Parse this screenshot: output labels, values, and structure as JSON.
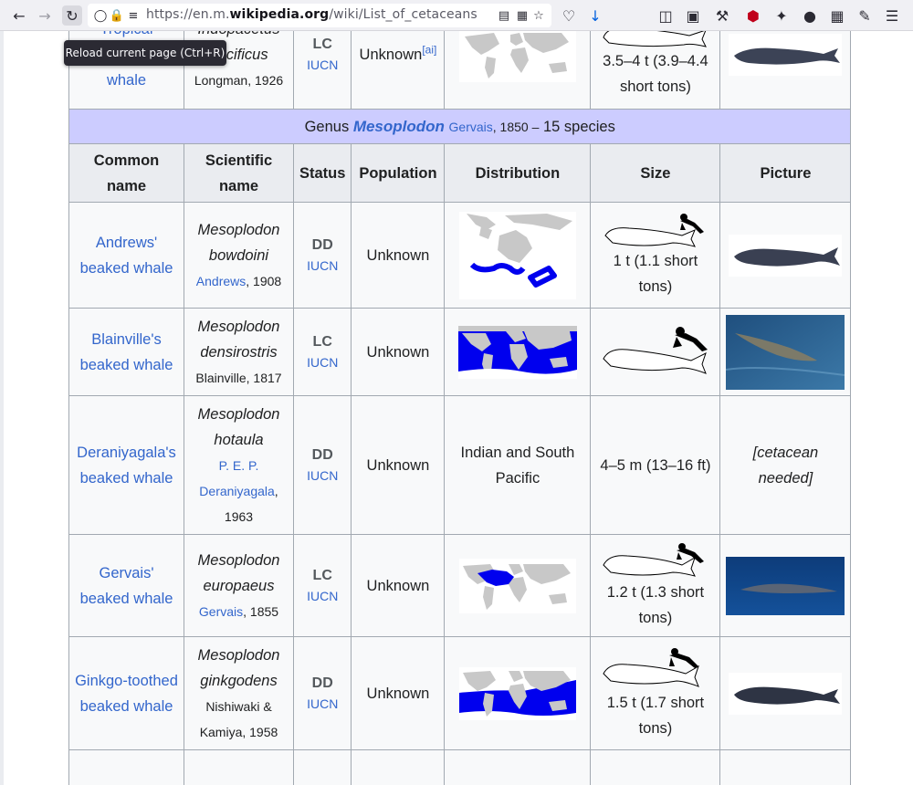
{
  "browser": {
    "url_prefix": "https://en.m.",
    "url_domain": "wikipedia.org",
    "url_path": "/wiki/List_of_cetaceans",
    "tooltip": "Reload current page (Ctrl+R)"
  },
  "prev_row": {
    "common": "Tropical bottlenose whale",
    "scientific": "Indopacetus pacificus",
    "authority": "Longman, 1926",
    "status": "LC",
    "iucn": "IUCN",
    "population": "Unknown",
    "population_note": "[ai]",
    "size": "3.5–4 t (3.9–4.4 short tons)"
  },
  "genus": {
    "prefix": "Genus",
    "name": "Mesoplodon",
    "author": "Gervais",
    "year": ", 1850 –",
    "count": "15 species"
  },
  "headers": {
    "common": "Common name",
    "scientific": "Scientific name",
    "status": "Status",
    "population": "Population",
    "distribution": "Distribution",
    "size": "Size",
    "picture": "Picture"
  },
  "rows": [
    {
      "common": "Andrews' beaked whale",
      "scientific": "Mesoplodon bowdoini",
      "authority_link": "Andrews",
      "authority_rest": ", 1908",
      "status": "DD",
      "iucn": "IUCN",
      "population": "Unknown",
      "size": "1 t (1.1 short tons)"
    },
    {
      "common": "Blainville's beaked whale",
      "scientific": "Mesoplodon densirostris",
      "authority_link": "",
      "authority_rest": "Blainville, 1817",
      "status": "LC",
      "iucn": "IUCN",
      "population": "Unknown",
      "size": ""
    },
    {
      "common": "Deraniyagala's beaked whale",
      "scientific": "Mesoplodon hotaula",
      "authority_link": "P. E. P. Deraniyagala",
      "authority_rest": ", 1963",
      "status": "DD",
      "iucn": "IUCN",
      "population": "Unknown",
      "distribution_text": "Indian and South Pacific",
      "size": "4–5 m (13–16 ft)",
      "picture_text": "[cetacean needed]"
    },
    {
      "common": "Gervais' beaked whale",
      "scientific": "Mesoplodon europaeus",
      "authority_link": "Gervais",
      "authority_rest": ", 1855",
      "status": "LC",
      "iucn": "IUCN",
      "population": "Unknown",
      "size": "1.2 t (1.3 short tons)"
    },
    {
      "common": "Ginkgo-toothed beaked whale",
      "scientific": "Mesoplodon ginkgodens",
      "authority_link": "",
      "authority_rest": "Nishiwaki & Kamiya, 1958",
      "status": "DD",
      "iucn": "IUCN",
      "population": "Unknown",
      "size": "1.5 t (1.7 short tons)"
    }
  ],
  "colors": {
    "link": "#3366cc",
    "genus_bg": "#ccccff",
    "range": "#0000ee",
    "land": "#c8c8c8"
  }
}
